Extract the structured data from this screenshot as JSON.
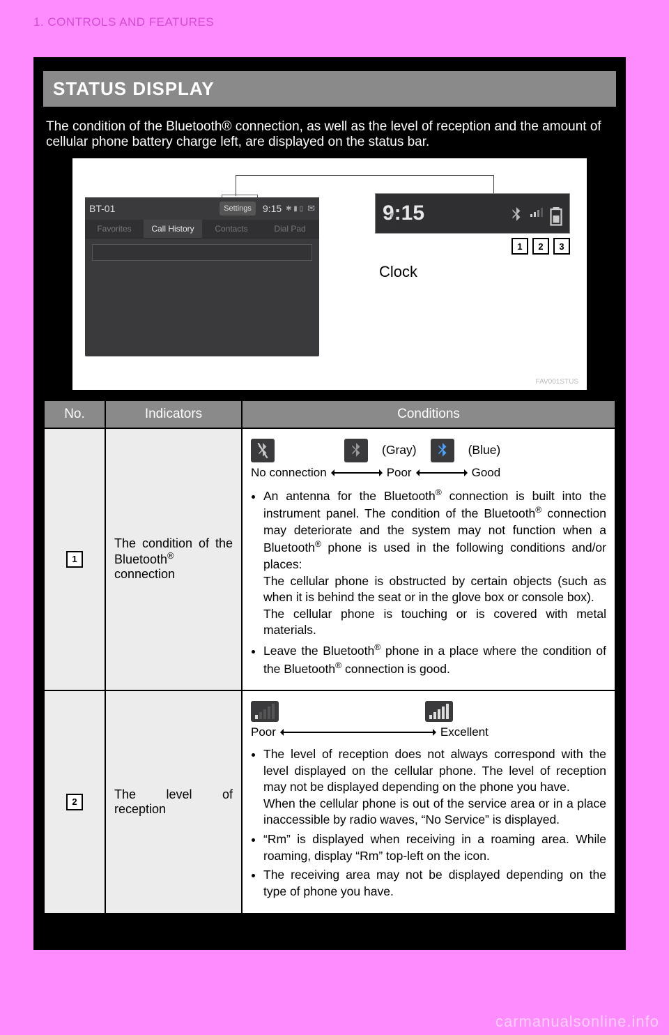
{
  "header": {
    "section": "1. CONTROLS AND FEATURES"
  },
  "title": "STATUS DISPLAY",
  "intro": "The condition of the Bluetooth® connection, as well as the level of reception and the amount of cellular phone battery charge left, are displayed on the status bar.",
  "figure": {
    "device_name": "BT-01",
    "settings_label": "Settings",
    "clock": "9:15",
    "tabs": [
      "Favorites",
      "Call History",
      "Contacts",
      "Dial Pad"
    ],
    "active_tab": "Call History",
    "callouts": [
      "1",
      "2",
      "3"
    ],
    "clock_label": "Clock",
    "tag": "FAV001STUS"
  },
  "table": {
    "headers": {
      "no": "No.",
      "indicators": "Indicators",
      "conditions": "Conditions"
    },
    "rows": [
      {
        "no": "1",
        "indicator": "The condition of the Bluetooth® connection",
        "scale": {
          "gray_label": " (Gray)",
          "blue_label": " (Blue)",
          "left": "No connection",
          "mid": "Poor",
          "right": "Good"
        },
        "bullets": [
          "An antenna for the Bluetooth® connection is built into the instrument panel. The condition of the Bluetooth® connection may deteriorate and the system may not function when a Bluetooth® phone is used in the following conditions and/or places:",
          "The cellular phone is obstructed by certain objects (such as when it is behind the seat or in the glove box or console box).",
          "The cellular phone is touching or is covered with metal materials.",
          "Leave the Bluetooth® phone in a place where the condition of the Bluetooth® connection is good."
        ]
      },
      {
        "no": "2",
        "indicator": "The level of reception",
        "scale": {
          "left": "Poor",
          "right": "Excellent"
        },
        "bullets": [
          "The level of reception does not always correspond with the level displayed on the cellular phone. The level of reception may not be displayed depending on the phone you have.",
          "When the cellular phone is out of the service area or in a place inaccessible by radio waves, “No Service” is displayed.",
          "“Rm” is displayed when receiving in a roaming area. While roaming, display “Rm” top-left on the icon.",
          "The receiving area may not be displayed depending on the type of phone you have."
        ]
      }
    ]
  },
  "watermark": "carmanualsonline.info"
}
